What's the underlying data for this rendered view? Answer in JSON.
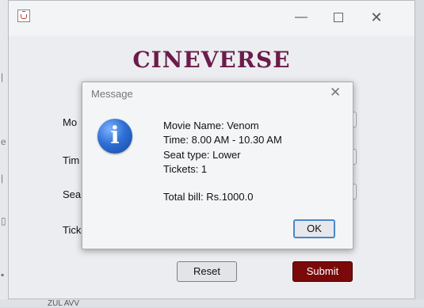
{
  "background": {
    "peek_text": "ZUL AVV"
  },
  "app": {
    "title": "CINEVERSE",
    "labels": [
      "Mo",
      "Tim",
      "Sea",
      "Tick"
    ],
    "buttons": {
      "reset": "Reset",
      "submit": "Submit"
    },
    "colors": {
      "brand": "#6b1c4a",
      "submit_bg": "#7a0a0a"
    }
  },
  "dialog": {
    "title": "Message",
    "icon": "info-icon",
    "lines": {
      "movie": "Movie Name: Venom",
      "time": "Time: 8.00 AM - 10.30 AM",
      "seat": "Seat type: Lower",
      "tickets": "Tickets: 1",
      "bill": "Total bill: Rs.1000.0"
    },
    "ok_label": "OK"
  }
}
